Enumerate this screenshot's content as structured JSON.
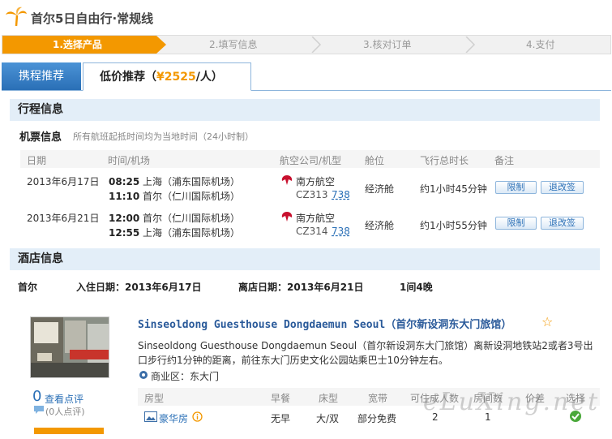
{
  "header": {
    "title": "首尔5日自由行·常规线"
  },
  "steps": [
    {
      "label": "1.选择产品",
      "active": true
    },
    {
      "label": "2.填写信息"
    },
    {
      "label": "3.核对订单"
    },
    {
      "label": "4.支付"
    }
  ],
  "tabs": {
    "recommend": "携程推荐",
    "lowprice_prefix": "低价推荐（",
    "lowprice_price": "¥2525",
    "lowprice_suffix": "/人）"
  },
  "itinerary": {
    "section_title": "行程信息",
    "ticket_title": "机票信息",
    "ticket_note": "所有航班起抵时间均为当地时间（24小时制）",
    "columns": [
      "日期",
      "时间/机场",
      "航空公司/机型",
      "舱位",
      "飞行总时长",
      "备注"
    ],
    "flights": [
      {
        "date": "2013年6月17日",
        "dep_time": "08:25",
        "dep_airport": "上海（浦东国际机场）",
        "arr_time": "11:10",
        "arr_airport": "首尔（仁川国际机场）",
        "airline": "南方航空",
        "flight_no": "CZ313",
        "aircraft": "738",
        "cabin": "经济舱",
        "duration": "约1小时45分钟",
        "btn_limit": "限制",
        "btn_change": "退改签"
      },
      {
        "date": "2013年6月21日",
        "dep_time": "12:00",
        "dep_airport": "首尔（仁川国际机场）",
        "arr_time": "12:55",
        "arr_airport": "上海（浦东国际机场）",
        "airline": "南方航空",
        "flight_no": "CZ314",
        "aircraft": "738",
        "cabin": "经济舱",
        "duration": "约1小时55分钟",
        "btn_limit": "限制",
        "btn_change": "退改签"
      }
    ]
  },
  "hotel": {
    "section_title": "酒店信息",
    "city": "首尔",
    "checkin": "入住日期：2013年6月17日",
    "checkout": "离店日期：2013年6月21日",
    "nights": "1间4晚",
    "name": "Sinseoldong Guesthouse Dongdaemun Seoul（首尔新设洞东大门旅馆）",
    "description": "Sinseoldong Guesthouse Dongdaemun Seoul（首尔新设洞东大门旅馆）离新设洞地铁站2或者3号出口步行约1分钟的距离，前往东大门历史文化公园站乘巴士10分钟左右。",
    "district": "商业区：东大门",
    "review_count": "0",
    "review_link": "查看点评",
    "review_people": "(0人点评)",
    "room_columns": [
      "房型",
      "早餐",
      "床型",
      "宽带",
      "可住成人数",
      "房间数",
      "价差",
      "选择"
    ],
    "room": {
      "type": "豪华房",
      "breakfast": "无早",
      "bed": "大/双",
      "broadband": "部分免费",
      "adults": "2",
      "rooms": "1"
    }
  },
  "watermark": "eLuXing.net",
  "colors": {
    "accent": "#f39800",
    "link": "#2a6fb6",
    "section_bg": "#e3eef8"
  }
}
